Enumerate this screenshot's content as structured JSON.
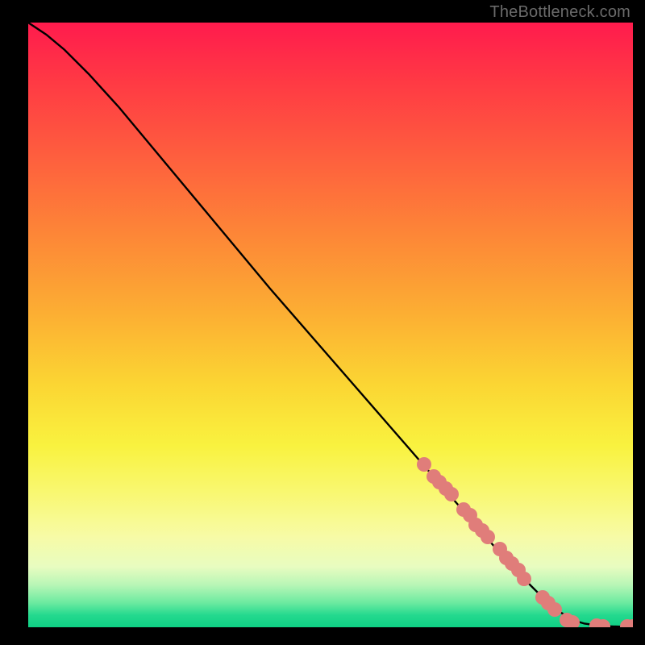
{
  "attribution": "TheBottleneck.com",
  "colors": {
    "dot": "#e07d7a",
    "curve": "#000000"
  },
  "chart_data": {
    "type": "line",
    "title": "",
    "xlabel": "",
    "ylabel": "",
    "xlim": [
      0,
      100
    ],
    "ylim": [
      0,
      100
    ],
    "grid": false,
    "series": [
      {
        "name": "curve",
        "x": [
          0,
          3,
          6,
          10,
          15,
          20,
          30,
          40,
          50,
          60,
          70,
          80,
          85,
          88,
          90,
          92,
          95,
          98,
          100
        ],
        "y": [
          100,
          98,
          95.5,
          91.5,
          86,
          80,
          68,
          56,
          44.5,
          33,
          21.5,
          10,
          5,
          2.5,
          1.2,
          0.6,
          0.2,
          0.1,
          0.1
        ]
      }
    ],
    "scatter": [
      {
        "name": "dots",
        "color": "#e07d7a",
        "points": [
          {
            "x": 65.5,
            "y": 27
          },
          {
            "x": 67,
            "y": 25
          },
          {
            "x": 68,
            "y": 24
          },
          {
            "x": 69,
            "y": 23
          },
          {
            "x": 70,
            "y": 22
          },
          {
            "x": 72,
            "y": 19.5
          },
          {
            "x": 73,
            "y": 18.5
          },
          {
            "x": 74,
            "y": 17
          },
          {
            "x": 75,
            "y": 16
          },
          {
            "x": 76,
            "y": 15
          },
          {
            "x": 78,
            "y": 13
          },
          {
            "x": 79,
            "y": 11.5
          },
          {
            "x": 80,
            "y": 10.5
          },
          {
            "x": 81,
            "y": 9.5
          },
          {
            "x": 82,
            "y": 8
          },
          {
            "x": 85,
            "y": 5
          },
          {
            "x": 86,
            "y": 4
          },
          {
            "x": 87,
            "y": 3
          },
          {
            "x": 89,
            "y": 1.2
          },
          {
            "x": 90,
            "y": 0.8
          },
          {
            "x": 94,
            "y": 0.3
          },
          {
            "x": 95,
            "y": 0.2
          },
          {
            "x": 99,
            "y": 0.1
          },
          {
            "x": 100,
            "y": 0.1
          }
        ]
      }
    ]
  }
}
